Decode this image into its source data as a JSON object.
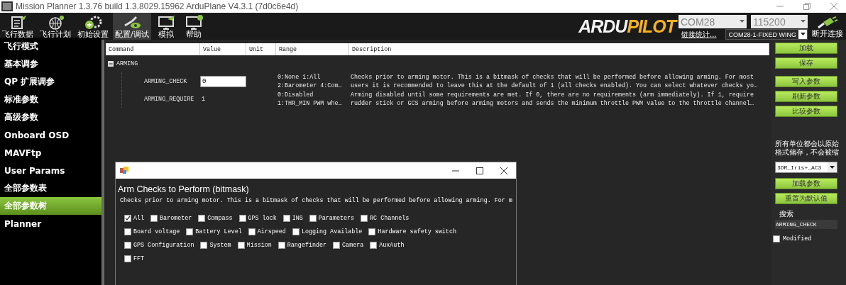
{
  "window": {
    "title": "Mission Planner 1.3.76 build 1.3.8029.15962 ArduPlane V4.3.1 (7d0c6e4d)"
  },
  "toolbar": {
    "items": [
      {
        "label": "飞行数据",
        "selected": false
      },
      {
        "label": "飞行计划",
        "selected": false
      },
      {
        "label": "初始设置",
        "selected": false
      },
      {
        "label": "配置/调试",
        "selected": true
      },
      {
        "label": "模拟",
        "selected": false
      },
      {
        "label": "帮助",
        "selected": false
      }
    ],
    "logo": [
      "ARDU",
      "PILOT"
    ],
    "port": "COM28",
    "baud": "115200",
    "link_stats": "链接统计...",
    "vehicle": "COM28-1-FIXED WING",
    "disconnect": "断开连接"
  },
  "sidebar": {
    "items": [
      {
        "label": "飞行模式",
        "selected": false
      },
      {
        "label": "基本调参",
        "selected": false
      },
      {
        "label": "QP 扩展调参",
        "selected": false
      },
      {
        "label": "标准参数",
        "selected": false
      },
      {
        "label": "高级参数",
        "selected": false
      },
      {
        "label": "Onboard OSD",
        "selected": false
      },
      {
        "label": "MAVFtp",
        "selected": false
      },
      {
        "label": "User Params",
        "selected": false
      },
      {
        "label": "全部参数表",
        "selected": false
      },
      {
        "label": "全部参数树",
        "selected": true
      },
      {
        "label": "Planner",
        "selected": false
      }
    ]
  },
  "table": {
    "columns": [
      "Command",
      "Value",
      "Unit",
      "Range",
      "Description"
    ],
    "group": {
      "name": "ARMING",
      "expanded": true
    },
    "rows": [
      {
        "command": "ARMING_CHECK",
        "value": "0",
        "editing": true,
        "range": [
          "0:None 1:All",
          "2:Barometer 4:Com…"
        ],
        "description": [
          "Checks prior to arming motor. This is a bitmask of checks that will be performed before allowing arming. For most",
          "users it is recommended to leave this at the default of 1 (all checks enabled). You can select whatever checks yo…"
        ]
      },
      {
        "command": "ARMING_REQUIRE",
        "value": "1",
        "editing": false,
        "range": [
          "0:Disabled",
          "1:THR_MIN PWM whe…"
        ],
        "description": [
          "Arming disabled until some requirements are met. If 0, there are no requirements (arm immediately).  If 1, require",
          "rudder stick or GCS arming before arming motors and sends the minimum throttle PWM value to the throttle channel…"
        ]
      }
    ]
  },
  "actions": {
    "buttons": [
      "加载",
      "保存",
      "写入参数",
      "刷新参数",
      "比较参数"
    ],
    "note": [
      "所有单位都会以原始",
      "格式储存，不会被缩"
    ],
    "preset": "3DR_Iris+_AC3",
    "preset_buttons": [
      "加载参数",
      "重置为默认值"
    ],
    "search_label": "搜索",
    "search_value": "ARMING_CHECK",
    "modified": {
      "label": "Modified",
      "checked": false
    }
  },
  "dialog": {
    "heading": "Arm Checks to Perform (bitmask)",
    "description": "Checks prior to arming motor. This is a bitmask of checks that will be performed before allowing arming. For m",
    "check_lines": [
      {
        "checks": [
          {
            "label": "All",
            "checked": true
          },
          {
            "label": "Barometer",
            "checked": false
          },
          {
            "label": "Compass",
            "checked": false
          },
          {
            "label": "GPS lock",
            "checked": false
          },
          {
            "label": "INS",
            "checked": false
          },
          {
            "label": "Parameters",
            "checked": false
          },
          {
            "label": "RC Channels",
            "checked": false
          }
        ]
      },
      {
        "checks": [
          {
            "label": "Board voltage",
            "checked": false
          },
          {
            "label": "Battery Level",
            "checked": false
          },
          {
            "label": "Airspeed",
            "checked": false
          },
          {
            "label": "Logging Available",
            "checked": false
          },
          {
            "label": "Hardware safety switch",
            "checked": false
          }
        ]
      },
      {
        "checks": [
          {
            "label": "GPS Configuration",
            "checked": false
          },
          {
            "label": "System",
            "checked": false
          },
          {
            "label": "Mission",
            "checked": false
          },
          {
            "label": "Rangefinder",
            "checked": false
          },
          {
            "label": "Camera",
            "checked": false
          },
          {
            "label": "AuxAuth",
            "checked": false
          }
        ]
      },
      {
        "checks": [
          {
            "label": "FFT",
            "checked": false
          }
        ]
      }
    ]
  }
}
